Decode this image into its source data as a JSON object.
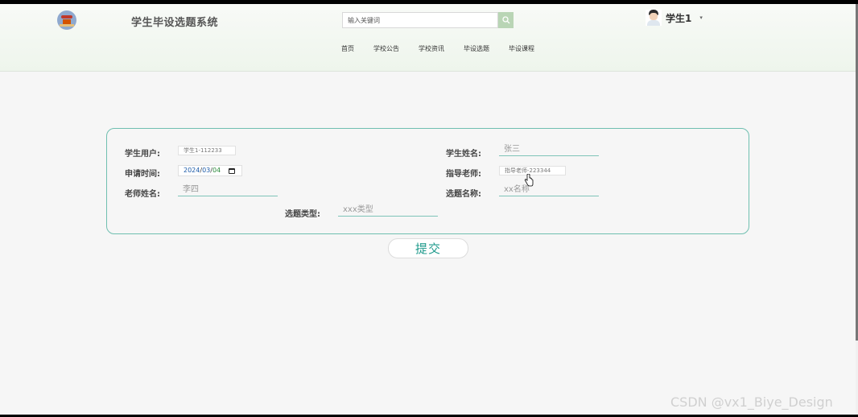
{
  "header": {
    "site_title": "学生毕设选题系统",
    "search": {
      "placeholder": "输入关键词",
      "value": ""
    },
    "user": {
      "name": "学生1",
      "caret": "▾"
    },
    "nav": [
      "首页",
      "学校公告",
      "学校资讯",
      "毕设选题",
      "毕设课程"
    ]
  },
  "form": {
    "student_user": {
      "label": "学生用户:",
      "value": "学生1-112233"
    },
    "student_name": {
      "label": "学生姓名:",
      "value": "张三"
    },
    "apply_time": {
      "label": "申请时间:",
      "year": "2024",
      "month": "03",
      "day": "04",
      "sep": "/"
    },
    "advisor": {
      "label": "指导老师:",
      "value": "指导老师-223344"
    },
    "teacher_name": {
      "label": "老师姓名:",
      "value": "李四"
    },
    "topic_name": {
      "label": "选题名称:",
      "value": "xx名称"
    },
    "topic_type": {
      "label": "选题类型:",
      "value": "xxx类型"
    }
  },
  "submit_label": "提交",
  "watermark": "CSDN @vx1_Biye_Design",
  "colors": {
    "accent": "#1f9a8c",
    "border": "#6fbfb0",
    "search_button": "#b9d5b5"
  },
  "icons": {
    "search": "search-icon",
    "calendar": "calendar-icon",
    "cursor": "hand-cursor-icon"
  }
}
